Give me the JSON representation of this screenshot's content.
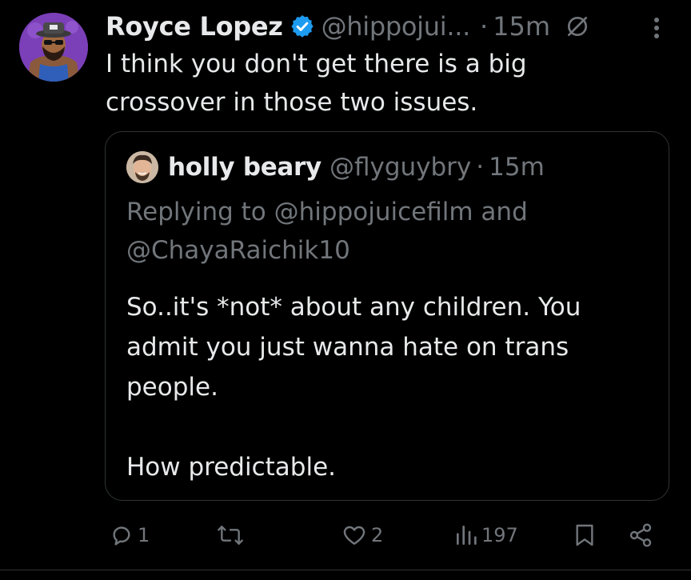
{
  "tweet": {
    "author_name": "Royce Lopez",
    "handle": "@hippojui...",
    "dot": "·",
    "time": "15m",
    "text": "I think you don't get there is a big\ncrossover in those two issues.",
    "verified": true
  },
  "quote": {
    "author_name": "holly beary",
    "handle": "@flyguybry",
    "dot": "·",
    "time": "15m",
    "replying_prefix": "Replying to",
    "reply_to_1": "@hippojuicefilm",
    "reply_and": "and",
    "reply_to_2": "@ChayaRaichik10",
    "text_line_1": "So..it's *not* about any children. You admit you just wanna hate on trans people.",
    "text_line_2": "How predictable."
  },
  "actions": {
    "replies": "1",
    "retweets": "",
    "likes": "2",
    "views": "197"
  },
  "icons": {
    "verified": "verified-badge-icon",
    "grok": "grok-icon",
    "more": "more-dots-icon",
    "reply": "reply-icon",
    "retweet": "retweet-icon",
    "like": "heart-icon",
    "views": "views-bar-icon",
    "bookmark": "bookmark-icon",
    "share": "share-icon"
  },
  "colors": {
    "background": "#000000",
    "text": "#e7e9ea",
    "muted": "#71767b",
    "border": "#2f3336",
    "verified": "#1d9bf0"
  }
}
